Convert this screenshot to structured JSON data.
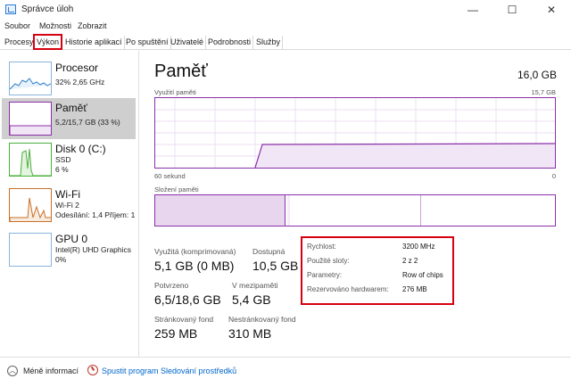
{
  "window": {
    "title": "Správce úloh",
    "minimize": "—",
    "maximize": "☐",
    "close": "✕"
  },
  "menu": [
    "Soubor",
    "Možnosti",
    "Zobrazit"
  ],
  "tabs": [
    "Procesy",
    "Výkon",
    "Historie aplikací",
    "Po spuštění",
    "Uživatelé",
    "Podrobnosti",
    "Služby"
  ],
  "sidebar": {
    "cpu": {
      "title": "Procesor",
      "sub1": "32% 2,65 GHz"
    },
    "memory": {
      "title": "Paměť",
      "sub1": "5,2/15,7 GB (33 %)"
    },
    "disk": {
      "title": "Disk 0 (C:)",
      "sub1": "SSD",
      "sub2": "6 %"
    },
    "wifi": {
      "title": "Wi-Fi",
      "sub1": "Wi-Fi 2",
      "sub2": "Odesílání: 1,4 Příjem: 1!"
    },
    "gpu": {
      "title": "GPU 0",
      "sub1": "Intel(R) UHD Graphics",
      "sub2": "0%"
    }
  },
  "main": {
    "title": "Paměť",
    "total": "16,0 GB",
    "usage_label": "Využití paměti",
    "usage_max": "15,7 GB",
    "time_left": "60 sekund",
    "time_right": "0",
    "composition_label": "Složení paměti"
  },
  "stats": {
    "in_use_label": "Využitá (komprimovaná)",
    "in_use_value": "5,1 GB (0 MB)",
    "available_label": "Dostupná",
    "available_value": "10,5 GB",
    "committed_label": "Potvrzeno",
    "committed_value": "6,5/18,6 GB",
    "cached_label": "V mezipaměti",
    "cached_value": "5,4 GB",
    "paged_label": "Stránkovaný fond",
    "paged_value": "259 MB",
    "nonpaged_label": "Nestránkovaný fond",
    "nonpaged_value": "310 MB"
  },
  "properties": [
    {
      "key": "Rychlost:",
      "value": "3200 MHz"
    },
    {
      "key": "Použité sloty:",
      "value": "2 z 2"
    },
    {
      "key": "Parametry:",
      "value": "Row of chips"
    },
    {
      "key": "Rezervováno hardwarem:",
      "value": "276 MB"
    }
  ],
  "footer": {
    "less_info": "Méně informací",
    "open_monitor": "Spustit program Sledování prostředků"
  },
  "colors": {
    "memory_accent": "#8b2fa8",
    "highlight_red": "#d6000f",
    "link_blue": "#0066cc",
    "cpu_blue": "#2f7fc8",
    "disk_green": "#4caf3e",
    "wifi_orange": "#c8702a"
  },
  "icons": {
    "app": "task-manager-icon",
    "less_info": "chevron-up-icon",
    "monitor": "resource-monitor-icon"
  }
}
